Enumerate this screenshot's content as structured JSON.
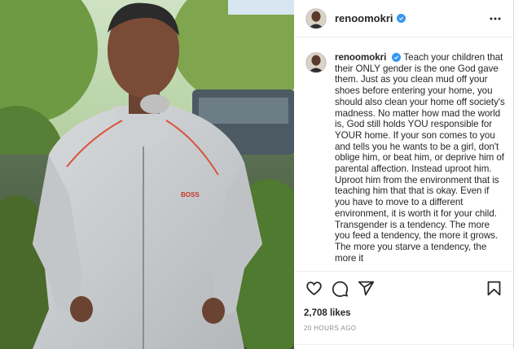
{
  "post": {
    "username": "renoomokri",
    "verified": true,
    "caption_username": "renoomokri",
    "caption": "Teach your children that their ONLY gender is the one God gave them. Just as you clean mud off your shoes before entering your home, you should also clean your home off society's madness. No matter how mad the world is, God still holds YOU responsible for YOUR home. If your son comes to you and tells you he wants to be a girl, don't oblige him, or beat him, or deprive him of parental affection. Instead uproot him. Uproot him from the environment that is teaching him that that is okay. Even if you have to move to a different environment, it is worth it for your child. Transgender is a tendency. The more you feed a tendency, the more it grows. The more you starve a tendency, the more it",
    "likes": "2,708 likes",
    "timestamp": "20 HOURS AGO",
    "jacket_logo": "BOSS"
  },
  "icons": {
    "more": "more-options-icon",
    "like": "heart-icon",
    "comment": "comment-icon",
    "share": "share-icon",
    "save": "bookmark-icon",
    "verified": "verified-badge-icon"
  },
  "colors": {
    "verified_blue": "#3897f0",
    "text": "#262626",
    "muted": "#8e8e8e",
    "border": "#dbdbdb"
  }
}
